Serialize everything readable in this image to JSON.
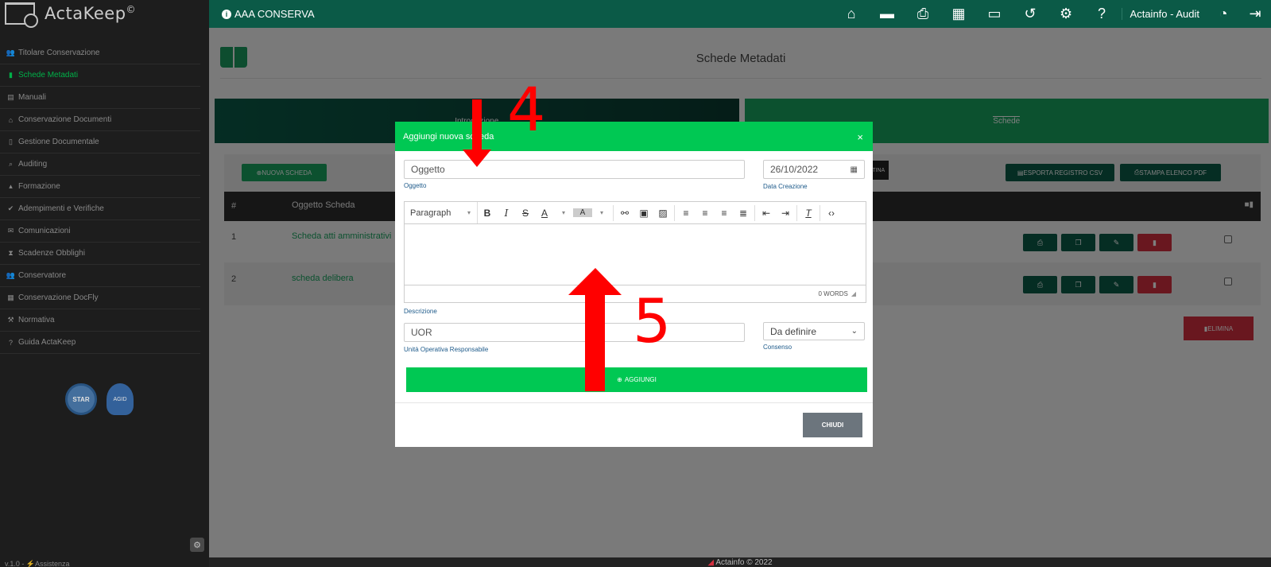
{
  "app": {
    "brand": "ActaKeep",
    "brand_mark": "©",
    "version": "v.1.0 - ⚡Assistenza"
  },
  "sidebar": {
    "items": [
      {
        "label": "Titolare Conservazione",
        "icon": "users-icon",
        "glyph": "👥",
        "active": false
      },
      {
        "label": "Schede Metadati",
        "icon": "book-icon",
        "glyph": "▮",
        "active": true
      },
      {
        "label": "Manuali",
        "icon": "manual-icon",
        "glyph": "▤",
        "active": false
      },
      {
        "label": "Conservazione Documenti",
        "icon": "archive-icon",
        "glyph": "⌂",
        "active": false
      },
      {
        "label": "Gestione Documentale",
        "icon": "file-icon",
        "glyph": "▯",
        "active": false
      },
      {
        "label": "Auditing",
        "icon": "search-icon",
        "glyph": "⌕",
        "active": false
      },
      {
        "label": "Formazione",
        "icon": "graduation-icon",
        "glyph": "▴",
        "active": false
      },
      {
        "label": "Adempimenti e Verifiche",
        "icon": "check-icon",
        "glyph": "✔",
        "active": false
      },
      {
        "label": "Comunicazioni",
        "icon": "envelope-icon",
        "glyph": "✉",
        "active": false
      },
      {
        "label": "Scadenze Obblighi",
        "icon": "hourglass-icon",
        "glyph": "⧗",
        "active": false
      },
      {
        "label": "Conservatore",
        "icon": "users-icon",
        "glyph": "👥",
        "active": false
      },
      {
        "label": "Conservazione DocFly",
        "icon": "box-icon",
        "glyph": "▦",
        "active": false
      },
      {
        "label": "Normativa",
        "icon": "gavel-icon",
        "glyph": "⚒",
        "active": false
      },
      {
        "label": "Guida ActaKeep",
        "icon": "question-icon",
        "glyph": "?",
        "active": false
      }
    ],
    "badge_star": "STAR",
    "badge_agid": "AGID"
  },
  "topbar": {
    "title": "AAA CONSERVA",
    "icons": [
      "home-icon",
      "folder-icon",
      "print-icon",
      "calendar-icon",
      "monitor-icon",
      "history-icon",
      "gear-icon",
      "help-icon"
    ],
    "icon_glyphs": [
      "⌂",
      "▬",
      "⎙",
      "▦",
      "▭",
      "↺",
      "⚙",
      "?"
    ],
    "user": "Actainfo - Audit"
  },
  "page": {
    "title": "Schede Metadati",
    "tabs": {
      "intro": "Introduzione",
      "schede": "Schede"
    },
    "buttons": {
      "nuova": "NUOVA SCHEDA",
      "cestina": "CESTINA",
      "esporta": "ESPORTA REGISTRO CSV",
      "stampa": "STAMPA ELENCO PDF",
      "elimina": "ELIMINA"
    },
    "table": {
      "headers": {
        "num": "#",
        "oggetto": "Oggetto Scheda"
      },
      "rows": [
        {
          "num": "1",
          "name": "Scheda atti amministrativi"
        },
        {
          "num": "2",
          "name": "scheda delibera"
        }
      ]
    }
  },
  "footer": {
    "text": "Actainfo © 2022"
  },
  "modal": {
    "title": "Aggiungi nuova scheda",
    "oggetto": {
      "placeholder": "Oggetto",
      "label": "Oggetto"
    },
    "data": {
      "value": "26/10/2022",
      "label": "Data Creazione"
    },
    "editor": {
      "paragraph": "Paragraph",
      "words": "0 WORDS",
      "label": "Descrizione"
    },
    "uor": {
      "placeholder": "UOR",
      "label": "Unità Operativa Responsabile"
    },
    "consenso": {
      "value": "Da definire",
      "label": "Consenso"
    },
    "aggiungi": "AGGIUNGI",
    "chiudi": "CHIUDI"
  },
  "annotations": {
    "step4": "4",
    "step5": "5",
    "color": "#ff0000"
  },
  "colors": {
    "brand_green": "#00c853",
    "dark_green": "#0b5a47",
    "danger": "#d32f3f",
    "sidebar_bg": "#222222"
  }
}
